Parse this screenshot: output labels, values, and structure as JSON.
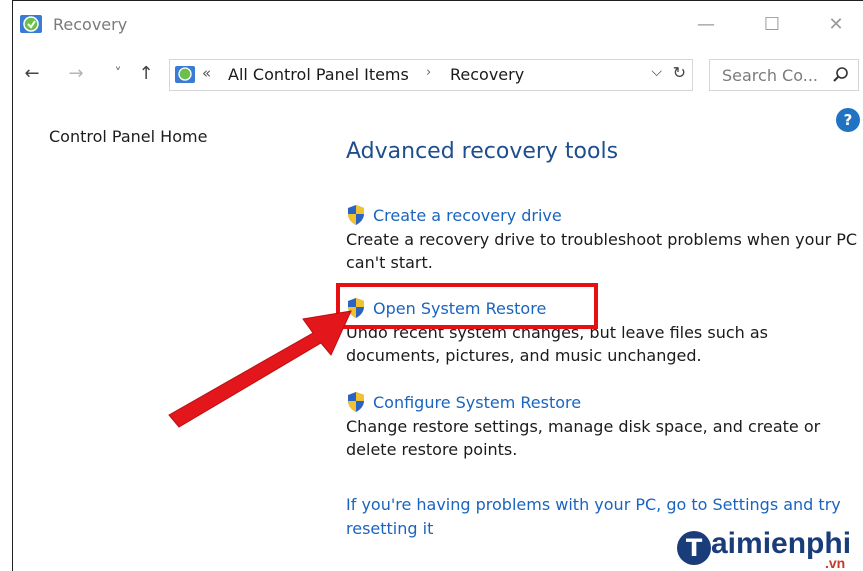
{
  "window": {
    "title": "Recovery",
    "controls": {
      "minimize": "—",
      "maximize": "☐",
      "close": "✕"
    }
  },
  "address_bar": {
    "overflow": "«",
    "crumbs": [
      "All Control Panel Items",
      "Recovery"
    ],
    "separator": "›"
  },
  "nav": {
    "back": "←",
    "forward": "→",
    "recent": "˅",
    "up": "↑"
  },
  "search": {
    "placeholder": "Search Co..."
  },
  "help": {
    "label": "?"
  },
  "sidebar": {
    "home_link": "Control Panel Home"
  },
  "main": {
    "heading": "Advanced recovery tools",
    "tasks": [
      {
        "label": "Create a recovery drive",
        "description": "Create a recovery drive to troubleshoot problems when your PC can't start."
      },
      {
        "label": "Open System Restore",
        "description": "Undo recent system changes, but leave files such as documents, pictures, and music unchanged."
      },
      {
        "label": "Configure System Restore",
        "description": "Change restore settings, manage disk space, and create or delete restore points."
      }
    ],
    "bottom_link": "If you're having problems with your PC, go to Settings and try resetting it"
  },
  "watermark": {
    "initial": "T",
    "name": "aimienphi",
    "tld": ".vn"
  },
  "colors": {
    "link": "#1a64c0",
    "heading": "#1e4e8c",
    "highlight": "#e60f12",
    "arrow": "#e3171b"
  }
}
